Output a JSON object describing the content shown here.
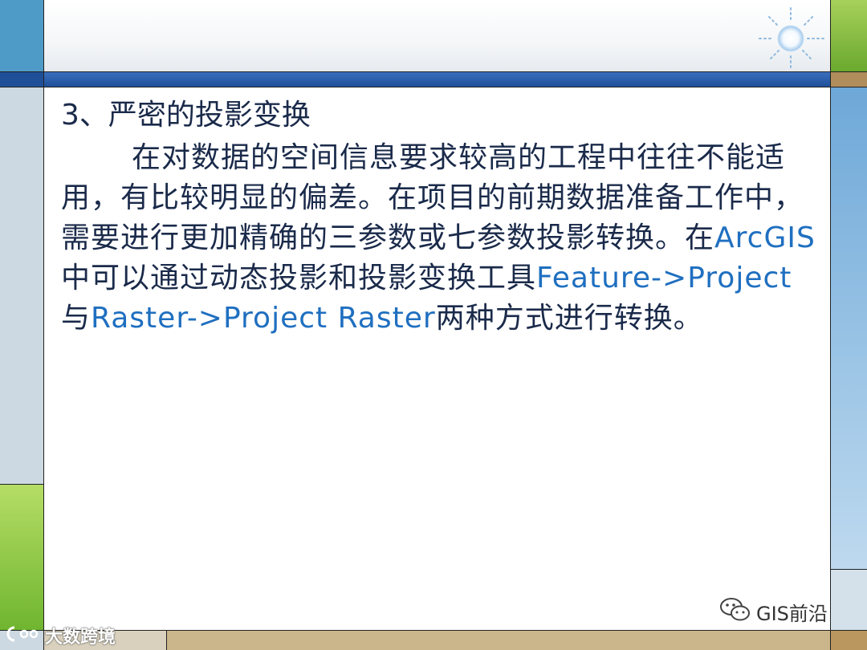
{
  "slide": {
    "title": "3、严密的投影变换",
    "paragraph": {
      "part1": "在对数据的空间信息要求较高的工程中往往不能适用，有比较明显的偏差。在项目的前期数据准备工作中，需要进行更加精确的三参数或七参数投影转换。在",
      "term1": "ArcGIS",
      "part2": "中可以通过动态投影和投影变换工具",
      "term2": "Feature->Project",
      "part3": "与",
      "term3": "Raster->Project Raster",
      "part4": "两种方式进行转换。"
    }
  },
  "watermarks": {
    "wechat": "GIS前沿",
    "bottom_left": "大数跨境"
  },
  "colors": {
    "text": "#1a2a4a",
    "highlight": "#1f6fc0",
    "header_bar": "#1f4f98",
    "accent_green": "#6fb52f",
    "accent_blue": "#4f9bc8"
  },
  "icons": [
    "sun-logo-icon",
    "wechat-icon",
    "cc-icon"
  ]
}
